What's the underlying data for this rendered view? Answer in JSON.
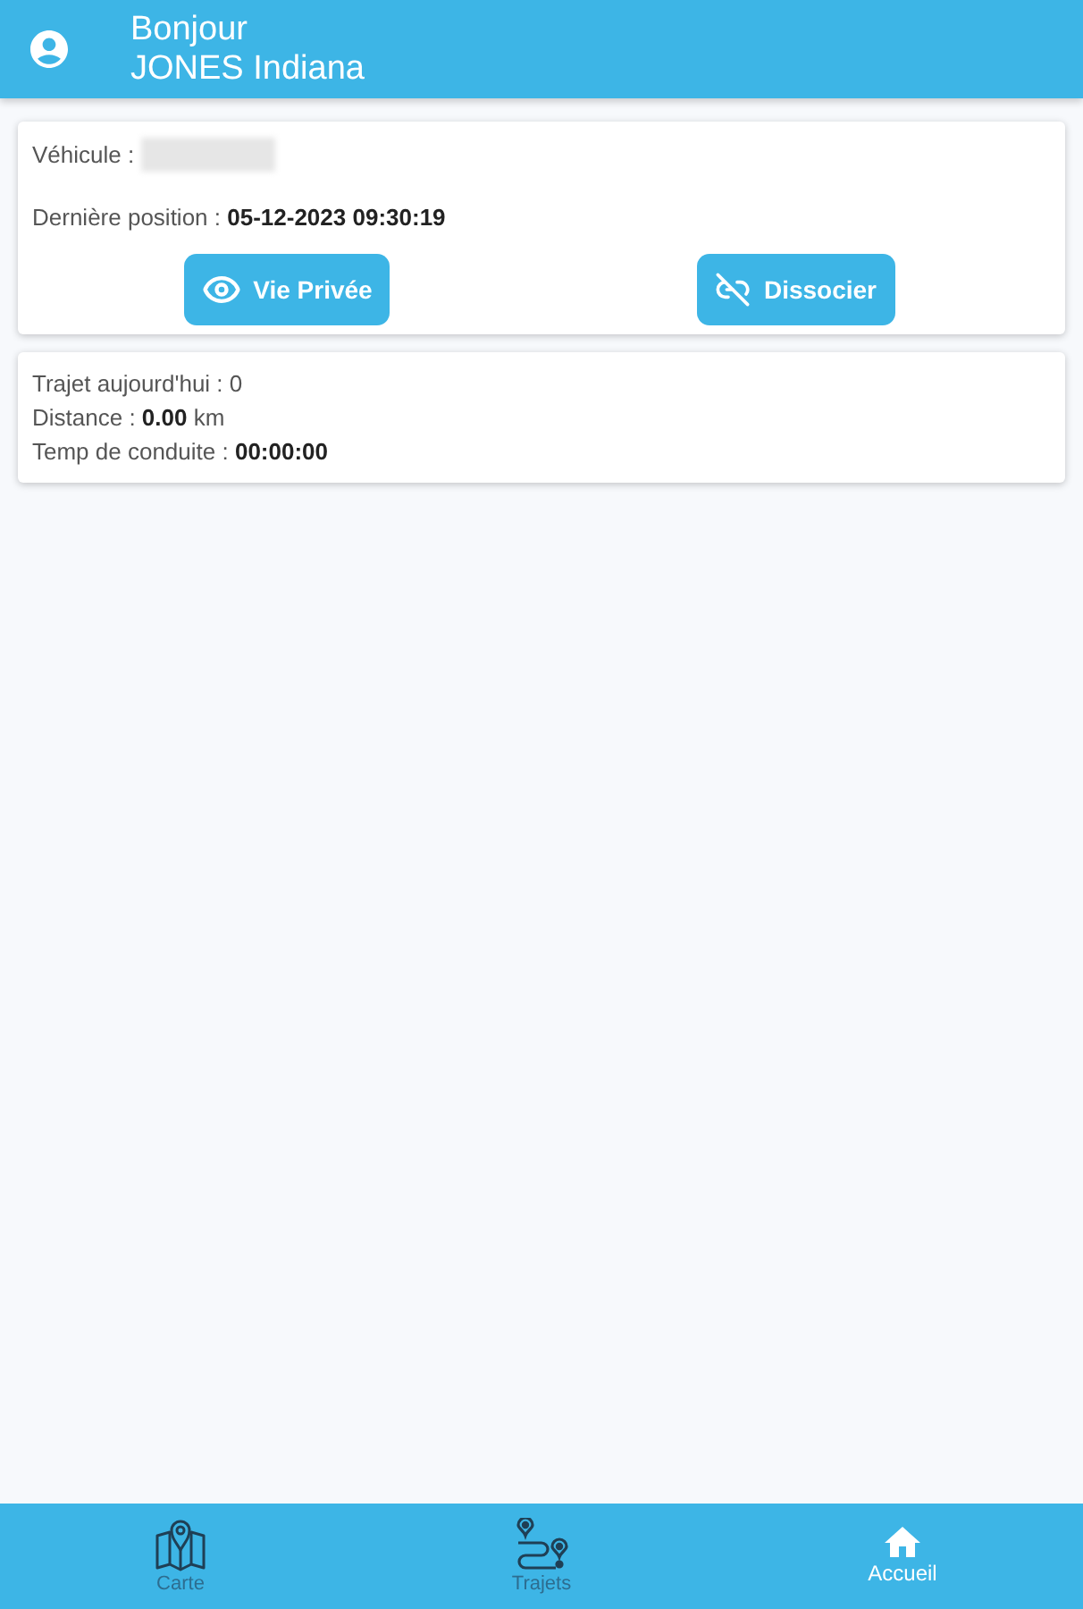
{
  "header": {
    "greeting": "Bonjour",
    "user_name": "JONES Indiana"
  },
  "vehicle_card": {
    "vehicle_label": "Véhicule :",
    "last_position": "Dernière position : **05-12-2023 09:30:19**",
    "buttons": [
      {
        "kind": "private",
        "label": "Vie Privée"
      },
      {
        "kind": "unlink",
        "label": "Dissocier"
      }
    ]
  },
  "stats_card": {
    "rows": [
      "Trajet aujourd'hui : 0",
      "Distance : **0.00** km",
      "Temp de conduite : **00:00:00**"
    ]
  },
  "bottom_nav": {
    "items": [
      {
        "kind": "map",
        "label": "Carte",
        "selected": false
      },
      {
        "kind": "route",
        "label": "Trajets",
        "selected": false
      },
      {
        "kind": "home",
        "label": "Accueil",
        "selected": true
      }
    ]
  }
}
